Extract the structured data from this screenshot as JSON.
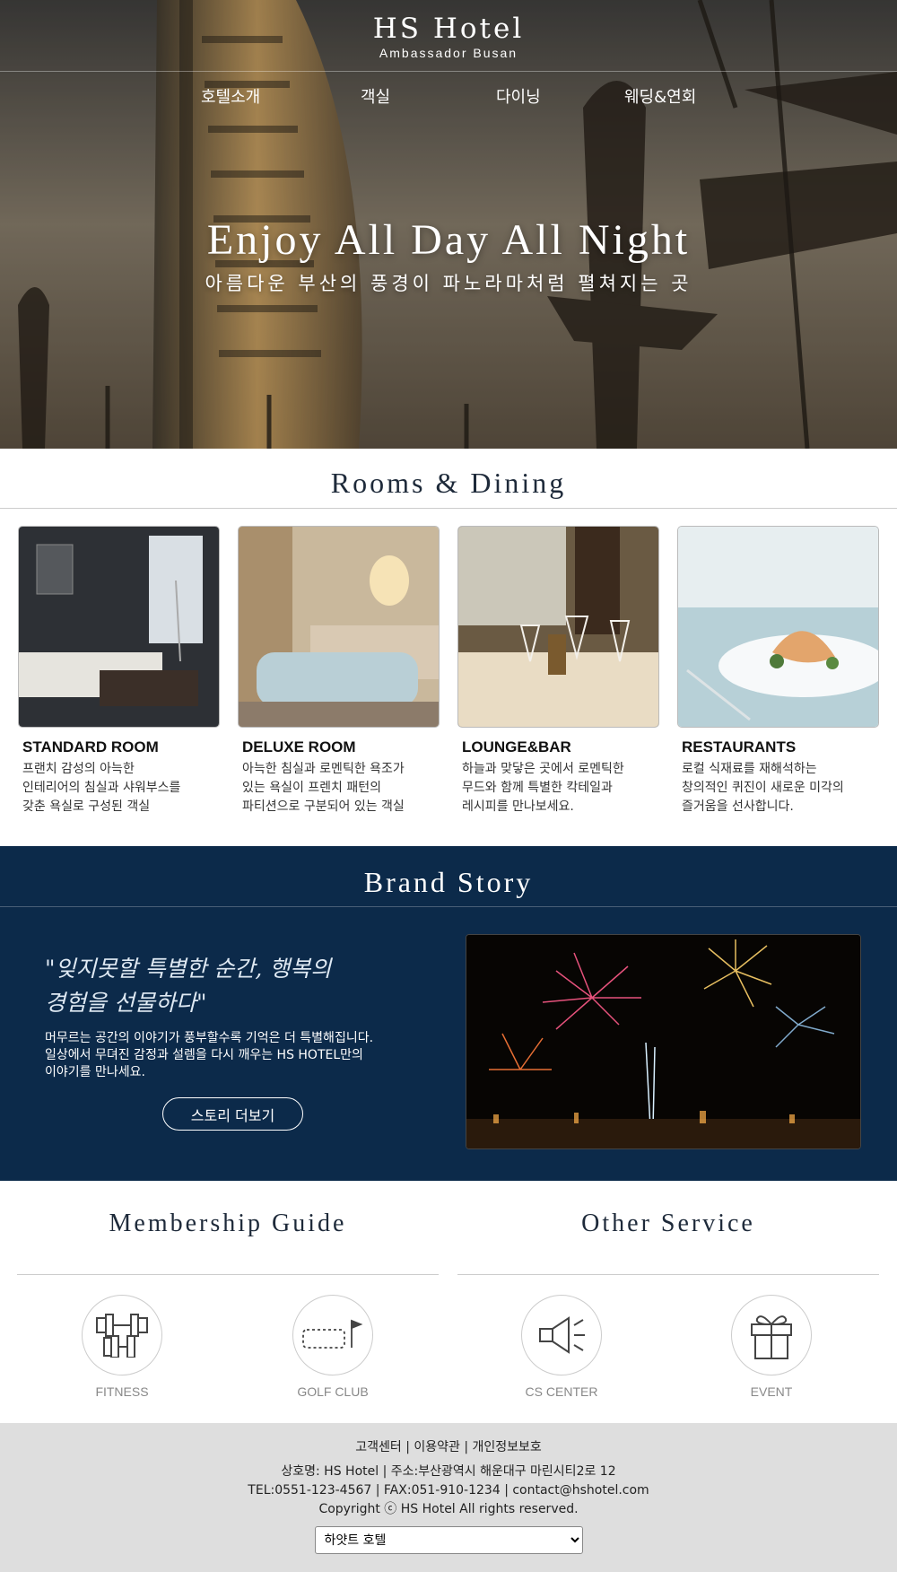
{
  "brand": {
    "name": "HS Hotel",
    "subtitle": "Ambassador Busan"
  },
  "nav": {
    "items": [
      "호텔소개",
      "객실",
      "다이닝",
      "웨딩&연회"
    ]
  },
  "hero": {
    "title": "Enjoy All Day All Night",
    "subtitle": "아름다운 부산의 풍경이 파노라마처럼 펼쳐지는 곳"
  },
  "rooms": {
    "title": "Rooms & Dining",
    "cards": [
      {
        "title": "STANDARD ROOM",
        "desc1": "프랜치 감성의 아늑한",
        "desc2": "인테리어의 침실과 샤워부스를",
        "desc3": "갖춘 욕실로 구성된 객실"
      },
      {
        "title": "DELUXE ROOM",
        "desc1": "아늑한 침실과 로멘틱한 욕조가",
        "desc2": "있는 욕실이 프렌치 패턴의",
        "desc3": "파티션으로 구분되어 있는 객실"
      },
      {
        "title": "LOUNGE&BAR",
        "desc1": "하늘과 맞닿은 곳에서 로멘틱한",
        "desc2": "무드와 함께 특별한 칵테일과",
        "desc3": "레시피를 만나보세요."
      },
      {
        "title": "RESTAURANTS",
        "desc1": "로컬 식재료를 재해석하는",
        "desc2": "창의적인 퀴진이 새로운 미각의",
        "desc3": "즐거움을 선사합니다."
      }
    ]
  },
  "story": {
    "title": "Brand Story",
    "quote1": "\"잊지못할 특별한 순간, 행복의",
    "quote2": "경험을 선물하다\"",
    "text1": "머무르는 공간의 이야기가 풍부할수록 기억은 더 특별해집니다.",
    "text2": "일상에서 무뎌진 감정과 설렘을 다시 깨우는 HS HOTEL만의",
    "text3": "이야기를 만나세요.",
    "button": "스토리 더보기"
  },
  "membership": {
    "title": "Membership Guide",
    "items": [
      {
        "label": "FITNESS",
        "icon": "dumbbell-icon"
      },
      {
        "label": "GOLF CLUB",
        "icon": "golf-flag-icon"
      }
    ]
  },
  "service": {
    "title": "Other Service",
    "items": [
      {
        "label": "CS CENTER",
        "icon": "megaphone-icon"
      },
      {
        "label": "EVENT",
        "icon": "gift-icon"
      }
    ]
  },
  "footer": {
    "links": [
      "고객센터",
      "이용약관",
      "개인정보보호"
    ],
    "separator": "|",
    "line1": "상호명: HS Hotel | 주소:부산광역시 해운대구 마린시티2로 12",
    "line2": "TEL:0551-123-4567 | FAX:051-910-1234 | contact@hshotel.com",
    "line3": "Copyright ⓒ HS Hotel All rights reserved.",
    "select_value": "하얏트 호텔"
  },
  "colors": {
    "navy": "#0c2a4a",
    "footer_bg": "#dedede",
    "accent_quote": "#dfe9f3"
  }
}
